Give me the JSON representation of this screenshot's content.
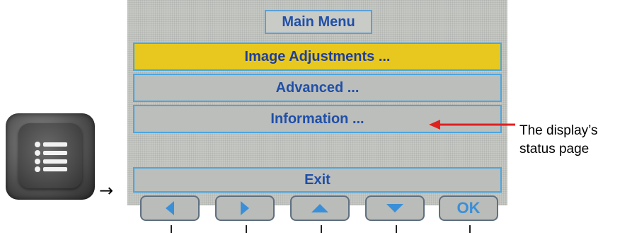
{
  "menu_key": {
    "icon": "list-icon"
  },
  "pointer_arrow": "→",
  "screen": {
    "title": "Main Menu",
    "items": [
      {
        "label": "Image Adjustments ...",
        "selected": true
      },
      {
        "label": "Advanced ...",
        "selected": false
      },
      {
        "label": "Information ...",
        "selected": false
      },
      {
        "label": "Exit",
        "selected": false
      }
    ],
    "nav_buttons": [
      {
        "icon": "left-arrow-icon"
      },
      {
        "icon": "right-arrow-icon"
      },
      {
        "icon": "up-arrow-icon"
      },
      {
        "icon": "down-arrow-icon"
      },
      {
        "label": "OK"
      }
    ]
  },
  "annotation": {
    "line1": "The display’s",
    "line2": "status page",
    "arrow_color": "#e02020"
  },
  "colors": {
    "selected_bg": "#e8c81e",
    "item_border": "#4aa6e0",
    "text_blue": "#1f4fa8",
    "arrow_blue": "#3b8fd8"
  }
}
